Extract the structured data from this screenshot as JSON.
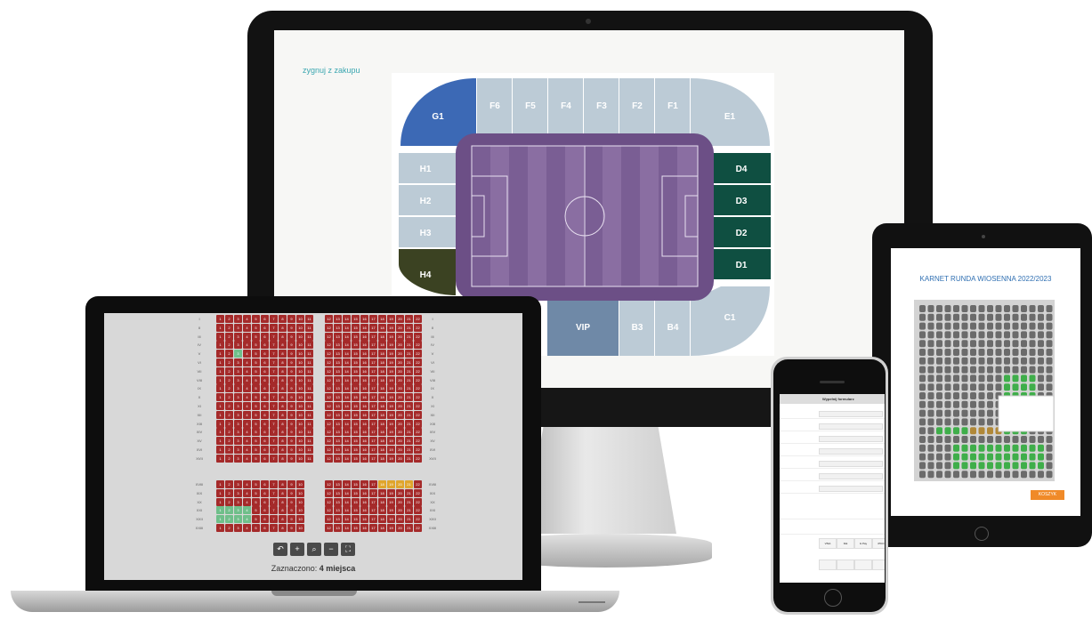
{
  "monitor": {
    "back_link": "zygnuj z zakupu",
    "sectors": {
      "g1": "G1",
      "f6": "F6",
      "f5": "F5",
      "f4": "F4",
      "f3": "F3",
      "f2": "F2",
      "f1": "F1",
      "e1": "E1",
      "h1": "H1",
      "h2": "H2",
      "h3": "H3",
      "h4": "H4",
      "d4": "D4",
      "d3": "D3",
      "d2": "D2",
      "d1": "D1",
      "vip": "VIP",
      "b3": "B3",
      "b4": "B4",
      "c1": "C1"
    },
    "colors": {
      "taken_dark": "#0f4f41",
      "g1": "#3c69b5",
      "h4": "#3b4222",
      "free": "#bccbd6",
      "vip": "#6f89a7",
      "pitch": "#6c4f86"
    }
  },
  "laptop": {
    "rows_top": [
      "I",
      "II",
      "III",
      "IV",
      "V",
      "VI",
      "VII",
      "VIII",
      "IX",
      "X",
      "XI",
      "XII",
      "XIII",
      "XIV",
      "XV",
      "XVI",
      "XVII"
    ],
    "rows_bottom": [
      "XVIII",
      "XIX",
      "XX",
      "XXI",
      "XXII",
      "XXIII"
    ],
    "seats_left": [
      "1",
      "2",
      "3",
      "4",
      "5",
      "6",
      "7",
      "8",
      "9",
      "10",
      "11"
    ],
    "seats_right": [
      "12",
      "13",
      "14",
      "15",
      "16",
      "17",
      "18",
      "19",
      "20",
      "21",
      "22"
    ],
    "selection_prefix": "Zaznaczono:",
    "selection_value": "4 miejsca",
    "tools": [
      {
        "icon": "undo-icon",
        "glyph": "↶"
      },
      {
        "icon": "plus-icon",
        "glyph": "+"
      },
      {
        "icon": "zoom-icon",
        "glyph": "⌕"
      },
      {
        "icon": "minus-icon",
        "glyph": "−"
      },
      {
        "icon": "fit-icon",
        "glyph": "⛶"
      }
    ],
    "colors": {
      "taken": "#a52a2a",
      "free": "#6fbf8a",
      "selected": "#e0a52c"
    }
  },
  "tablet": {
    "title": "KARNET RUNDA WIOSENNA 2022/2023",
    "cart_button": "KOSZYK"
  },
  "phone": {
    "tab_back": "Wypełnij formularz",
    "payment_logos": [
      "VISA",
      "blik",
      "G Pay",
      "iPKO"
    ]
  }
}
